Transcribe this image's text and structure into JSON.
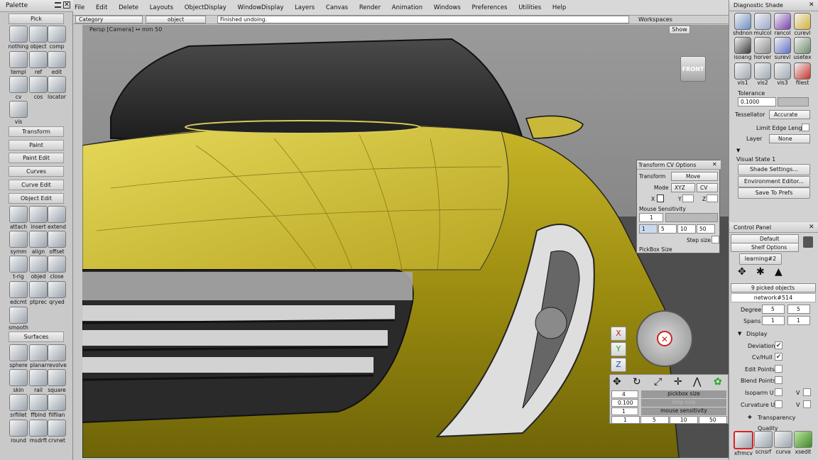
{
  "menubar": {
    "items": [
      "File",
      "Edit",
      "Delete",
      "Layouts",
      "ObjectDisplay",
      "WindowDisplay",
      "Layers",
      "Canvas",
      "Render",
      "Animation",
      "Windows",
      "Preferences",
      "Utilities",
      "Help"
    ],
    "workspaces": "Workspaces"
  },
  "subbar": {
    "category": "Category",
    "object": "object",
    "status": "Finished undoing."
  },
  "viewport": {
    "camera": "Persp [Camera]",
    "units": "↔ mm",
    "zoom": "50",
    "show": "Show",
    "view_cube": "FRONT"
  },
  "palette": {
    "title": "Palette",
    "pick_header": "Pick",
    "pick_tools": [
      "nothing",
      "object",
      "comp",
      "templ",
      "ref",
      "edit",
      "cv",
      "cos",
      "locator",
      "vis"
    ],
    "sections": [
      "Transform",
      "Paint",
      "Paint Edit",
      "Curves",
      "Curve Edit"
    ],
    "object_edit_header": "Object Edit",
    "object_edit_tools": [
      "attach",
      "insert",
      "extend",
      "symm",
      "align",
      "offset",
      "t-rig",
      "objed",
      "close",
      "edcmt",
      "ptprec",
      "qryed",
      "smooth"
    ],
    "surfaces_header": "Surfaces",
    "surface_tools": [
      "sphere",
      "planar",
      "revolve",
      "skin",
      "rail",
      "square",
      "srfillet",
      "ffblnd",
      "filfilan",
      "round",
      "msdrft",
      "crvnet"
    ]
  },
  "transform_cv": {
    "title": "Transform CV Options",
    "transform_label": "Transform",
    "transform_value": "Move",
    "mode_label": "Mode",
    "mode_xyz": "XYZ",
    "mode_cv": "CV",
    "x": "X",
    "y": "Y",
    "z": "Z",
    "mouse_sensitivity": "Mouse Sensitivity",
    "sens_value": "1",
    "sens_steps": [
      "1",
      "5",
      "10",
      "50"
    ],
    "step_size": "Step size",
    "pickbox_size": "PickBox Size"
  },
  "bottom_panel": {
    "rows": [
      {
        "value": "4",
        "label": "pickbox size"
      },
      {
        "value": "0.100",
        "label": "step size"
      },
      {
        "value": "1",
        "label": "mouse sensitivity"
      }
    ],
    "steps": [
      "1",
      "5",
      "10",
      "50"
    ],
    "axes": [
      "X",
      "Y",
      "Z"
    ]
  },
  "diag_shade": {
    "title": "Diagnostic Shade",
    "icons": [
      "shdnon",
      "mulcol",
      "rancol",
      "curevl",
      "isoang",
      "horver",
      "surevl",
      "usetex",
      "vis1",
      "vis2",
      "vis3",
      "filest"
    ],
    "colors": [
      "#6b8fc4",
      "#9aa8c9",
      "#7a3fb0",
      "#d4b13a",
      "#3a3a3a",
      "#8a8a8a",
      "#5f6fc6",
      "#6c8a6c",
      "#9ea9b2",
      "#9ea9b2",
      "#9ea9b2",
      "#c8322c"
    ],
    "tolerance_label": "Tolerance",
    "tolerance_value": "0.1000",
    "tessellator_label": "Tessellator",
    "tessellator_value": "Accurate",
    "limit_edge": "Limit Edge Length",
    "layer_label": "Layer",
    "layer_value": "None",
    "visual_state": "Visual State 1",
    "buttons": [
      "Shade Settings...",
      "Environment Editor...",
      "Save To Prefs"
    ]
  },
  "control_panel": {
    "title": "Control Panel",
    "default": "Default",
    "shelf_options": "Shelf Options",
    "shelf_tab": "learning#2",
    "picked": "9 picked objects",
    "network": "network#514",
    "degree_label": "Degree",
    "degree": [
      "5",
      "5"
    ],
    "spans_label": "Spans",
    "spans": [
      "1",
      "1"
    ],
    "display_header": "Display",
    "toggles": [
      {
        "label": "Deviation",
        "checked": "✔"
      },
      {
        "label": "Cv/Hull",
        "checked": "✔"
      },
      {
        "label": "Edit Points",
        "checked": ""
      },
      {
        "label": "Blend Points",
        "checked": ""
      }
    ],
    "isoparm": "Isoparm U",
    "curvature": "Curvature U",
    "v": "V",
    "transparency": "Transparency",
    "quality": "Quality",
    "shelf_tools": [
      "xfrmcv",
      "scnsrf",
      "curva",
      "xsedit"
    ]
  }
}
